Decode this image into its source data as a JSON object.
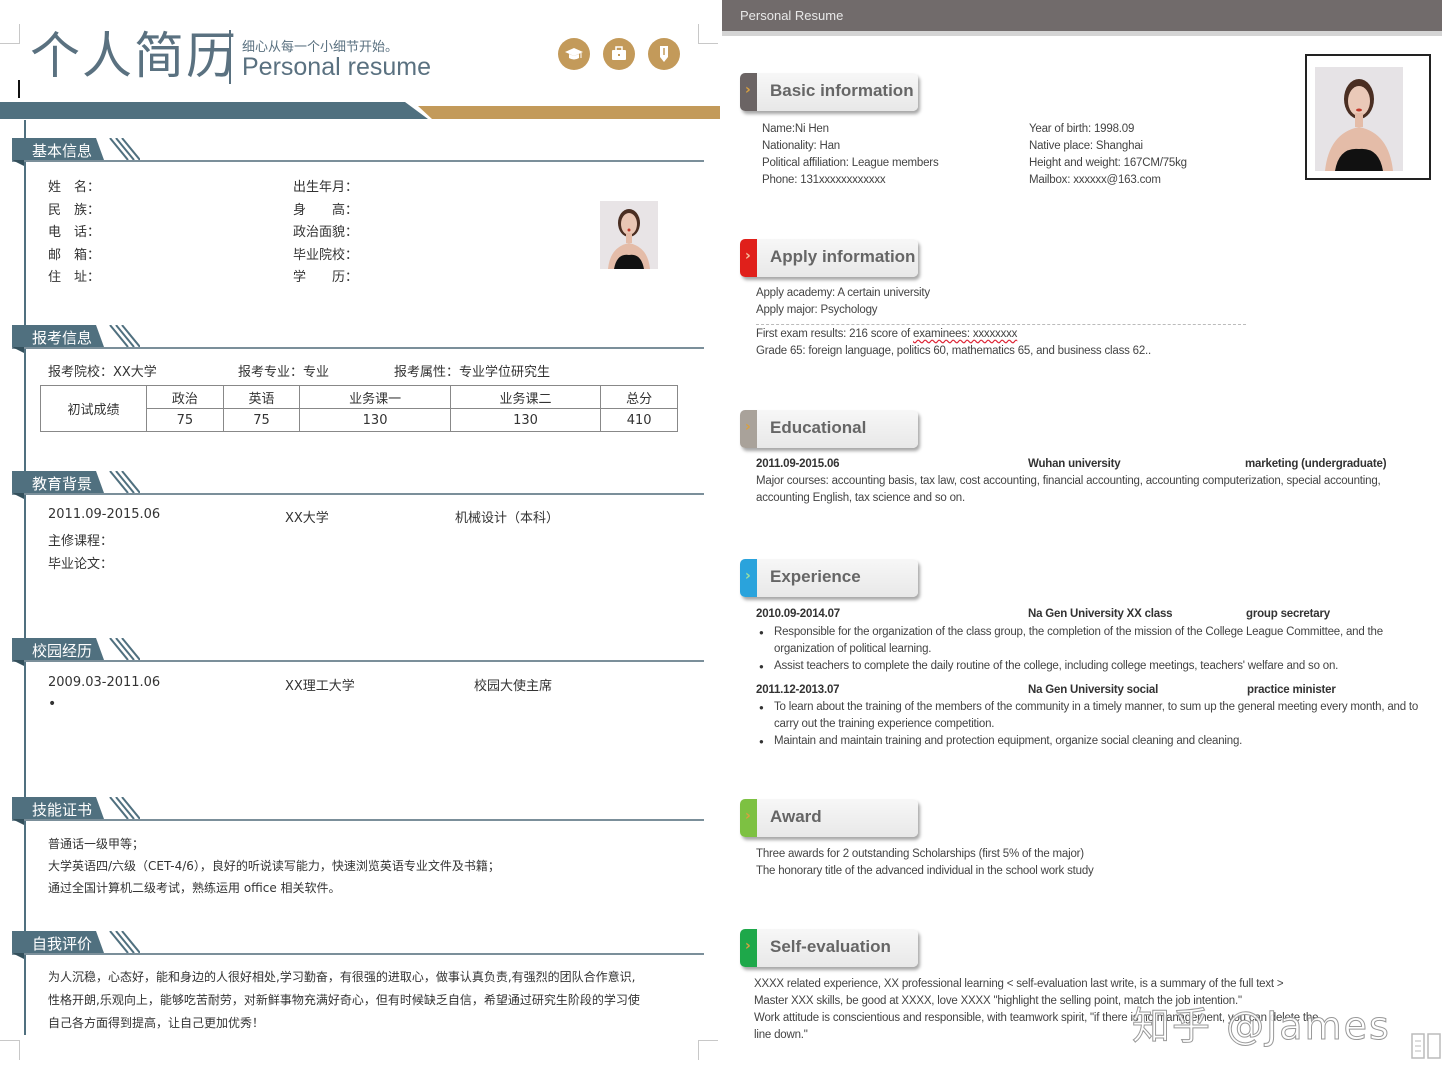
{
  "left": {
    "title_cn": "个人简历",
    "slogan": "细心从每一个小细节开始。",
    "subtitle": "Personal resume",
    "header_icons": [
      "graduation-cap-icon",
      "briefcase-icon",
      "pencil-icon"
    ],
    "colors": {
      "primary": "#50707f",
      "accent": "#c39a5a"
    },
    "sections": {
      "basic": {
        "title": "基本信息",
        "left_fields": [
          "姓　名：",
          "民　族：",
          "电　话：",
          "邮　箱：",
          "住　址："
        ],
        "right_fields": [
          "出生年月：",
          "身　　高：",
          "政治面貌：",
          "毕业院校：",
          "学　　历："
        ]
      },
      "apply": {
        "title": "报考信息",
        "school": "报考院校：XX大学",
        "major": "报考专业：专业",
        "type": "报考属性：专业学位研究生",
        "score_label": "初试成绩",
        "score_headers": [
          "政治",
          "英语",
          "业务课一",
          "业务课二",
          "总分"
        ],
        "score_values": [
          "75",
          "75",
          "130",
          "130",
          "410"
        ]
      },
      "education": {
        "title": "教育背景",
        "period": "2011.09-2015.06",
        "school": "XX大学",
        "major": "机械设计（本科）",
        "courses": "主修课程：",
        "thesis": "毕业论文："
      },
      "campus": {
        "title": "校园经历",
        "period": "2009.03-2011.06",
        "school": "XX理工大学",
        "role": "校园大使主席",
        "bullet": "•"
      },
      "skills": {
        "title": "技能证书",
        "lines": [
          "普通话一级甲等；",
          "大学英语四/六级（CET-4/6），良好的听说读写能力，快速浏览英语专业文件及书籍；",
          "通过全国计算机二级考试，熟练运用 office 相关软件。"
        ]
      },
      "self": {
        "title": "自我评价",
        "lines": [
          "为人沉稳，心态好，能和身边的人很好相处,学习勤奋，有很强的进取心，做事认真负责,有强烈的团队合作意识,",
          "性格开朗,乐观向上，能够吃苦耐劳，对新鲜事物充满好奇心，但有时候缺乏自信，希望通过研究生阶段的学习使",
          "自己各方面得到提高，让自己更加优秀！"
        ]
      }
    }
  },
  "right": {
    "topbar_title": "Personal Resume",
    "sections": {
      "basic": {
        "title": "Basic information",
        "accent": "#6b6464",
        "left": [
          "Name:Ni Hen",
          "Nationality: Han",
          "Political affiliation: League members",
          "Phone: 131xxxxxxxxxxxx"
        ],
        "right": [
          "Year of birth: 1998.09",
          "Native place: Shanghai",
          "Height and weight: 167CM/75kg",
          "Mailbox: xxxxxx@163.com"
        ]
      },
      "apply": {
        "title": "Apply information",
        "accent": "#e0201b",
        "lines": [
          "Apply academy: A certain university",
          "Apply major: Psychology"
        ],
        "exam_prefix": "First exam results: 216 score of ",
        "exam_underlined": "examinees: xxxxxxxx",
        "grade": "Grade 65: foreign language, politics 60, mathematics 65, and business class 62.."
      },
      "education": {
        "title": "Educational",
        "accent": "#a9a29a",
        "period": "2011.09-2015.06",
        "school": "Wuhan university",
        "major": "marketing (undergraduate)",
        "courses": "Major courses: accounting basis, tax law, cost accounting, financial accounting, accounting computerization, special accounting, accounting English, tax science and so on."
      },
      "experience": {
        "title": "Experience",
        "accent": "#2aa3dc",
        "entries": [
          {
            "period": "2010.09-2014.07",
            "org": "Na Gen University XX class",
            "role": "group secretary",
            "bullets": [
              "Responsible for the organization of the class group, the completion of the mission of the College League Committee, and the organization of political learning.",
              "Assist teachers to complete the daily routine of the college, including college meetings, teachers' welfare and so on."
            ]
          },
          {
            "period": "2011.12-2013.07",
            "org": "Na Gen University social",
            "role": "practice minister",
            "bullets": [
              "To learn about the training of the members of the community in a timely manner, to sum up the general meeting every month, and to carry out the training experience competition.",
              "Maintain and maintain training and protection equipment, organize social cleaning and cleaning."
            ]
          }
        ]
      },
      "award": {
        "title": "Award",
        "accent": "#7dc142",
        "lines": [
          "Three awards for 2 outstanding Scholarships (first 5% of the major)",
          "The honorary title of the advanced individual in the school work study"
        ]
      },
      "self": {
        "title": "Self-evaluation",
        "accent": "#1ea84a",
        "lines": [
          "XXXX related experience, XX professional learning < self-evaluation last write, is a summary of the full text >",
          "Master XXX skills, be good at XXXX, love XXXX \"highlight the selling point, match the job intention.\"",
          "Work attitude is conscientious and responsible, with teamwork spirit, \"if there is no management, you can delete the",
          "line down.\""
        ]
      }
    },
    "watermark": "知乎 @James"
  }
}
